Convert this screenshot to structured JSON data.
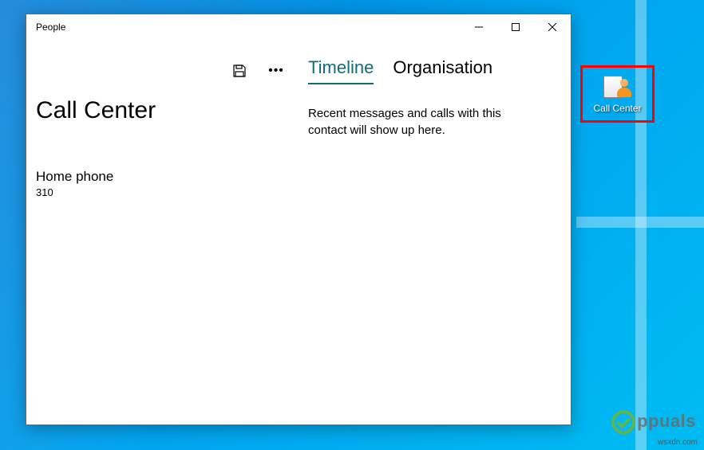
{
  "window": {
    "title": "People"
  },
  "contact": {
    "name": "Call Center",
    "fields": [
      {
        "label": "Home phone",
        "value": "310"
      }
    ]
  },
  "toolbar": {
    "save_tooltip": "Save",
    "more_tooltip": "More"
  },
  "tabs": [
    {
      "label": "Timeline",
      "active": true
    },
    {
      "label": "Organisation",
      "active": false
    }
  ],
  "timeline": {
    "empty_message": "Recent messages and calls with this contact will show up here."
  },
  "desktop_shortcut": {
    "label": "Call Center"
  },
  "watermark": {
    "site": "wsxdn.com",
    "brand": "ppuals"
  },
  "colors": {
    "accent": "#0c6f78",
    "highlight": "#ff0000",
    "desktop_start": "#0078d4",
    "desktop_end": "#00bcf2"
  }
}
